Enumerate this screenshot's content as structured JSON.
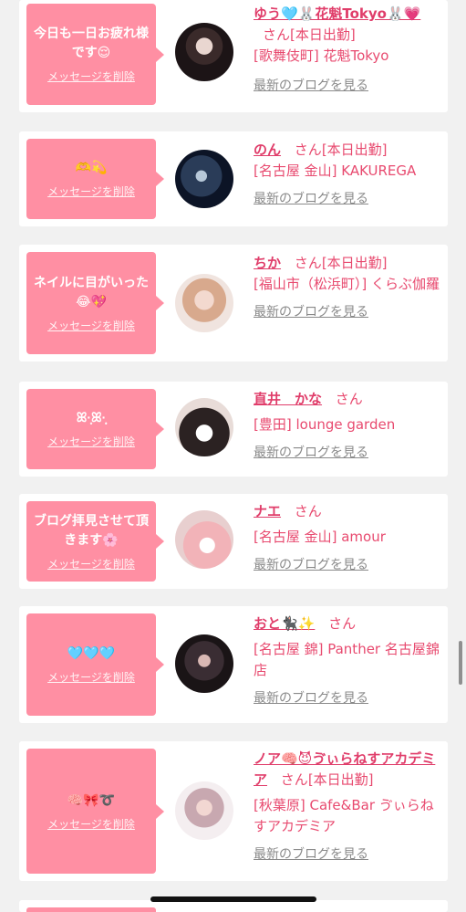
{
  "colors": {
    "bubble": "#ff8fa3",
    "name": "#e03d6a",
    "text": "#e84a6f",
    "blog": "#8a8a8a",
    "background": "#f1f1f1"
  },
  "delete_label": "メッセージを削除",
  "blog_label": "最新のブログを見る",
  "cards": [
    {
      "message": "今日も一日お疲れ様です😌",
      "name": "ゆう🩵🐰花魁Tokyo🐰💗",
      "honorific": "さん",
      "status": "[本日出勤]",
      "shop": "[歌舞伎町] 花魁Tokyo"
    },
    {
      "message": "🫶💫",
      "name": "のん",
      "honorific": "さん",
      "status": "[本日出勤]",
      "shop": "[名古屋 金山] KAKUREGA"
    },
    {
      "message": "ネイルに目がいった😂💖",
      "name": "ちか",
      "honorific": "さん",
      "status": "[本日出勤]",
      "shop": "[福山市（松浜町）] くらぶ伽羅"
    },
    {
      "message": "ꕤ·̩͙ꕤ·̩͙",
      "name": "直井　かな",
      "honorific": "さん",
      "status": "",
      "shop": "[豊田] lounge garden"
    },
    {
      "message": "ブログ拝見させて頂きます🌸",
      "name": "ナエ",
      "honorific": "さん",
      "status": "",
      "shop": "[名古屋 金山] amour"
    },
    {
      "message": "🩵🩵🩵",
      "name": "おと🐈‍⬛✨",
      "honorific": "さん",
      "status": "",
      "shop": "[名古屋 錦] Panther 名古屋錦店"
    },
    {
      "message": "🧠🎀➰",
      "name": "ノア🧠😈ゔぃらねすアカデミア",
      "honorific": "さん",
      "status": "[本日出勤]",
      "shop": "[秋葉原] Cafe&Bar ゔぃらねすアカデミア"
    }
  ]
}
